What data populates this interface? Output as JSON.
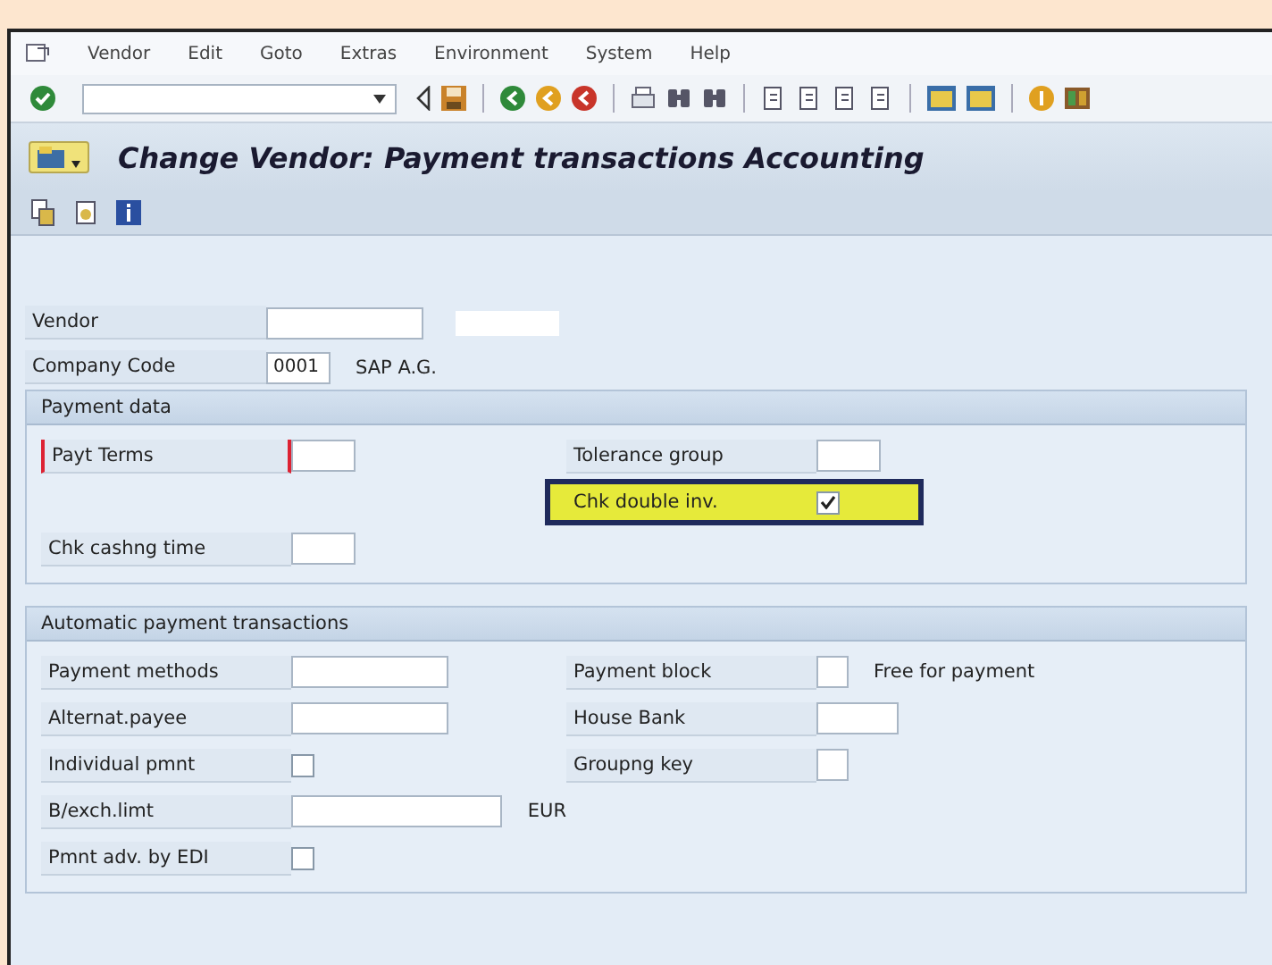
{
  "menu": [
    "Vendor",
    "Edit",
    "Goto",
    "Extras",
    "Environment",
    "System",
    "Help"
  ],
  "title": "Change Vendor: Payment transactions Accounting",
  "header_fields": [
    {
      "label": "Vendor",
      "kind": "text_field",
      "redacted": true
    },
    {
      "label": "Company Code",
      "kind": "code_field",
      "value": "0001",
      "description": "SAP A.G."
    }
  ],
  "groups": [
    {
      "title": "Payment data",
      "rows": [
        {
          "left": {
            "label": "Payt Terms",
            "kind": "code_field",
            "required": true
          },
          "right": {
            "label": "Tolerance group",
            "kind": "code_field"
          }
        },
        {
          "right": {
            "label": "Chk double inv.",
            "kind": "checkbox",
            "checked": true,
            "highlighted": true
          }
        },
        {
          "left": {
            "label": "Chk cashng time",
            "kind": "code_field"
          }
        }
      ]
    },
    {
      "title": "Automatic payment transactions",
      "rows": [
        {
          "left": {
            "label": "Payment methods",
            "kind": "text_field"
          },
          "right": {
            "label": "Payment block",
            "kind": "flag_field",
            "description": "Free for payment"
          }
        },
        {
          "left": {
            "label": "Alternat.payee",
            "kind": "text_field"
          },
          "right": {
            "label": "House Bank",
            "kind": "short_field"
          }
        },
        {
          "left": {
            "label": "Individual pmnt",
            "kind": "checkbox",
            "checked": false
          },
          "right": {
            "label": "Groupng key",
            "kind": "flag_field"
          }
        },
        {
          "left": {
            "label": "B/exch.limt",
            "kind": "amount_field",
            "unit": "EUR"
          }
        },
        {
          "left": {
            "label": "Pmnt adv. by EDI",
            "kind": "checkbox",
            "checked": false
          }
        }
      ]
    }
  ]
}
